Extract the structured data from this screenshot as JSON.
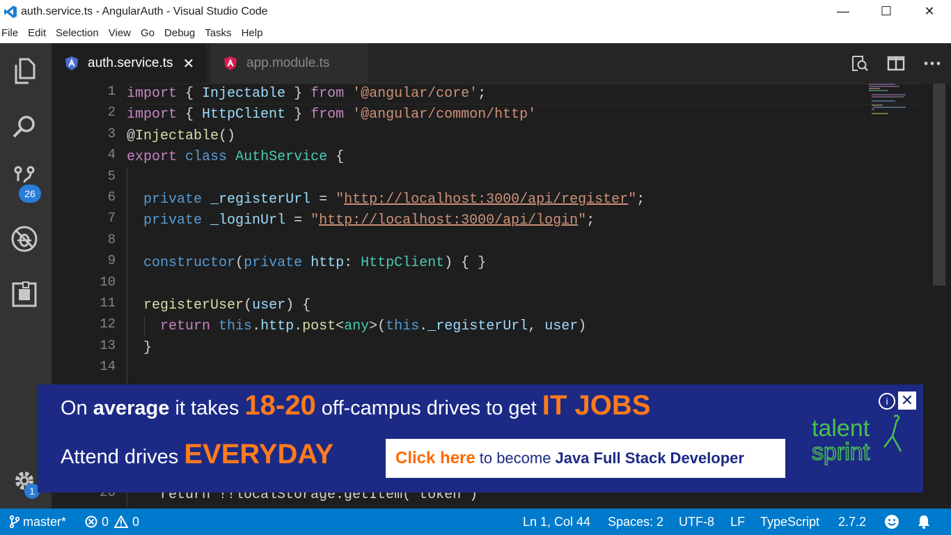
{
  "window": {
    "title": "auth.service.ts - AngularAuth - Visual Studio Code",
    "minimize": "—",
    "maximize": "☐",
    "close": "✕"
  },
  "menu": [
    "File",
    "Edit",
    "Selection",
    "View",
    "Go",
    "Debug",
    "Tasks",
    "Help"
  ],
  "activity": {
    "scm_badge": "26",
    "settings_badge": "1"
  },
  "tabs": [
    {
      "label": "auth.service.ts",
      "close": "✕"
    },
    {
      "label": "app.module.ts"
    }
  ],
  "editor": {
    "line_numbers": [
      "1",
      "2",
      "3",
      "4",
      "5",
      "6",
      "7",
      "8",
      "9",
      "10",
      "11",
      "12",
      "13",
      "14"
    ],
    "hidden_line_number": "20",
    "lines": [
      [
        {
          "t": "import",
          "c": "kw"
        },
        {
          "t": " { "
        },
        {
          "t": "Injectable",
          "c": "vr"
        },
        {
          "t": " } "
        },
        {
          "t": "from",
          "c": "kw"
        },
        {
          "t": " "
        },
        {
          "t": "'@angular/core'",
          "c": "st"
        },
        {
          "t": ";"
        }
      ],
      [
        {
          "t": "import",
          "c": "kw"
        },
        {
          "t": " { "
        },
        {
          "t": "HttpClient",
          "c": "vr"
        },
        {
          "t": " } "
        },
        {
          "t": "from",
          "c": "kw"
        },
        {
          "t": " "
        },
        {
          "t": "'@angular/common/http'",
          "c": "st"
        }
      ],
      [
        {
          "t": "@"
        },
        {
          "t": "Injectable",
          "c": "fn"
        },
        {
          "t": "()"
        }
      ],
      [
        {
          "t": "export",
          "c": "kw"
        },
        {
          "t": " "
        },
        {
          "t": "class",
          "c": "kb"
        },
        {
          "t": " "
        },
        {
          "t": "AuthService",
          "c": "ty"
        },
        {
          "t": " {"
        }
      ],
      [],
      [
        {
          "t": "  "
        },
        {
          "t": "private",
          "c": "kb"
        },
        {
          "t": " "
        },
        {
          "t": "_registerUrl",
          "c": "vr"
        },
        {
          "t": " = "
        },
        {
          "t": "\"",
          "c": "st"
        },
        {
          "t": "http://localhost:3000/api/register",
          "c": "url"
        },
        {
          "t": "\"",
          "c": "st"
        },
        {
          "t": ";"
        }
      ],
      [
        {
          "t": "  "
        },
        {
          "t": "private",
          "c": "kb"
        },
        {
          "t": " "
        },
        {
          "t": "_loginUrl",
          "c": "vr"
        },
        {
          "t": " = "
        },
        {
          "t": "\"",
          "c": "st"
        },
        {
          "t": "http://localhost:3000/api/login",
          "c": "url"
        },
        {
          "t": "\"",
          "c": "st"
        },
        {
          "t": ";"
        }
      ],
      [],
      [
        {
          "t": "  "
        },
        {
          "t": "constructor",
          "c": "kb"
        },
        {
          "t": "("
        },
        {
          "t": "private",
          "c": "kb"
        },
        {
          "t": " "
        },
        {
          "t": "http",
          "c": "vr"
        },
        {
          "t": ": "
        },
        {
          "t": "HttpClient",
          "c": "ty"
        },
        {
          "t": ") { }"
        }
      ],
      [],
      [
        {
          "t": "  "
        },
        {
          "t": "registerUser",
          "c": "fn"
        },
        {
          "t": "("
        },
        {
          "t": "user",
          "c": "vr"
        },
        {
          "t": ") {"
        }
      ],
      [
        {
          "t": "    "
        },
        {
          "t": "return",
          "c": "kw"
        },
        {
          "t": " "
        },
        {
          "t": "this",
          "c": "kb"
        },
        {
          "t": "."
        },
        {
          "t": "http",
          "c": "vr"
        },
        {
          "t": "."
        },
        {
          "t": "post",
          "c": "fn"
        },
        {
          "t": "<"
        },
        {
          "t": "any",
          "c": "ty"
        },
        {
          "t": ">("
        },
        {
          "t": "this",
          "c": "kb"
        },
        {
          "t": "."
        },
        {
          "t": "_registerUrl",
          "c": "vr"
        },
        {
          "t": ", "
        },
        {
          "t": "user",
          "c": "vr"
        },
        {
          "t": ")"
        }
      ],
      [
        {
          "t": "  }"
        }
      ],
      []
    ],
    "hidden_line": "    return !!localStorage.getItem('token')"
  },
  "ad": {
    "l1_a": "On",
    "l1_b": "average",
    "l1_c": "it takes",
    "l1_num": "18-20",
    "l1_d": "off-campus drives to get",
    "l1_it": "IT JOBS",
    "l2_a": "Attend drives",
    "l2_every": "EVERYDAY",
    "cta_click": "Click here",
    "cta_mid": "to become",
    "cta_job": "Java Full Stack Developer",
    "logo_top": "talent",
    "logo_bottom": "sprint",
    "info": "i",
    "close": "✕"
  },
  "status": {
    "branch": "master*",
    "errors": "0",
    "warnings": "0",
    "position": "Ln 1, Col 44",
    "spaces": "Spaces: 2",
    "encoding": "UTF-8",
    "eol": "LF",
    "language": "TypeScript",
    "version": "2.7.2"
  },
  "colors": {
    "statusbar": "#007acc",
    "ad_bg": "#1c2a86",
    "ad_accent": "#ff7b1c",
    "logo_green": "#49c14f"
  }
}
